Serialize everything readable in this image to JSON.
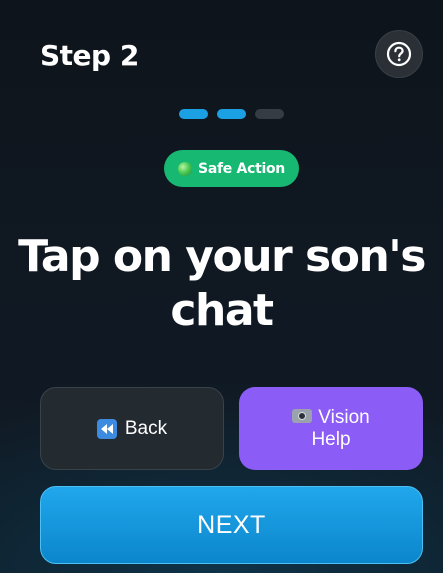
{
  "header": {
    "title": "Step 2",
    "help_icon": "question-circle-icon"
  },
  "progress": {
    "current_step": 2,
    "total_steps": 3
  },
  "badge": {
    "label": "Safe Action",
    "color": "#16b872"
  },
  "instruction": {
    "line1": "Tap on your son's",
    "line2": "chat"
  },
  "buttons": {
    "back_label": "Back",
    "back_icon": "rewind-icon",
    "vision_line1": "Vision",
    "vision_line2": "Help",
    "vision_icon": "camera-icon",
    "next_label": "NEXT"
  },
  "colors": {
    "accent": "#1ca0e4",
    "vision": "#8b5cf6",
    "back": "#232a30"
  }
}
